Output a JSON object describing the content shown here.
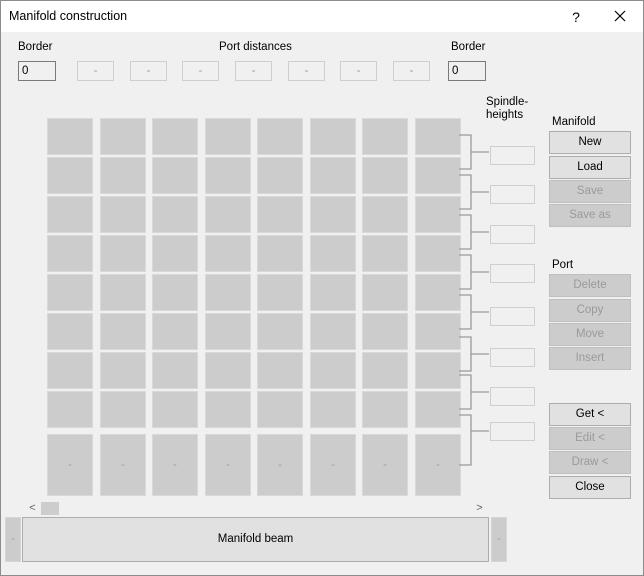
{
  "window": {
    "title": "Manifold construction",
    "help": "?"
  },
  "labels": {
    "border_left": "Border",
    "port_distances": "Port distances",
    "border_right": "Border",
    "spindle": "Spindle-",
    "heights": "heights",
    "manifold": "Manifold",
    "port": "Port"
  },
  "fields": {
    "border_left": "0",
    "border_right": "0",
    "distances": [
      "-",
      "-",
      "-",
      "-",
      "-",
      "-",
      "-"
    ]
  },
  "bottom_cells": [
    "-",
    "-",
    "-",
    "-",
    "-",
    "-",
    "-",
    "-"
  ],
  "manifold_buttons": {
    "new": "New",
    "load": "Load",
    "save": "Save",
    "save_as": "Save as"
  },
  "port_buttons": {
    "delete": "Delete",
    "copy": "Copy",
    "move": "Move",
    "insert": "Insert"
  },
  "action_buttons": {
    "get": "Get <",
    "edit": "Edit <",
    "draw": "Draw <",
    "close": "Close"
  },
  "scroll": {
    "left": "<",
    "right": ">"
  },
  "beam": {
    "label": "Manifold beam",
    "left_mark": "-",
    "right_mark": "-"
  }
}
